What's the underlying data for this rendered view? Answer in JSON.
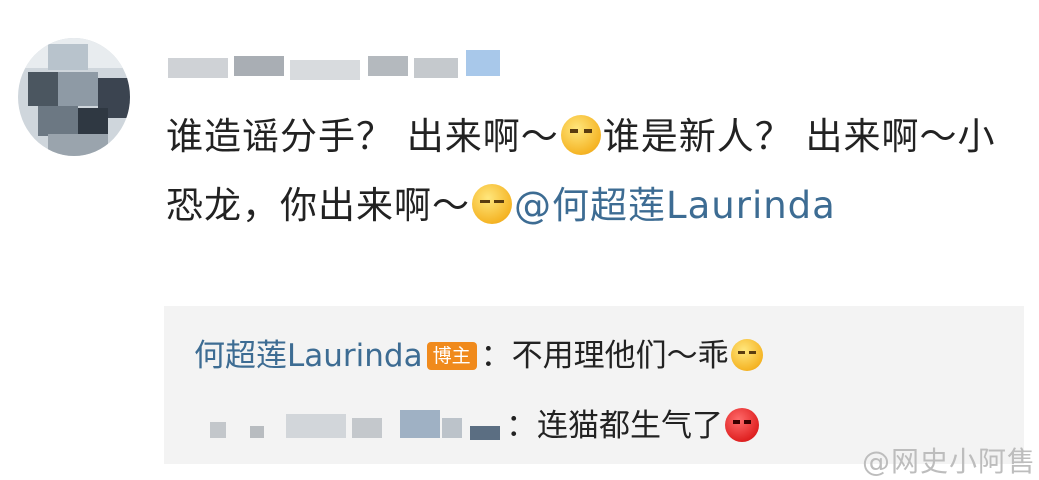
{
  "comment": {
    "text_part1": "谁造谣分手？ 出来啊～",
    "text_part2": "谁是新人？ 出来啊～小恐龙，你出来啊～",
    "mention": "@何超莲Laurinda"
  },
  "reply_1": {
    "author": "何超莲Laurinda",
    "badge": "博主",
    "text": "：不用理他们～乖"
  },
  "reply_2": {
    "text": "：连猫都生气了"
  },
  "watermark": "@网史小阿售",
  "colors": {
    "mention": "#3d6c93",
    "badge": "#f08a1c",
    "reply_background": "#f3f3f3"
  },
  "icons": {
    "emoji_1": "dizzy-face-emoji",
    "emoji_2": "smirk-face-emoji",
    "emoji_3": "kissing-face-emoji",
    "emoji_4": "angry-face-emoji"
  }
}
